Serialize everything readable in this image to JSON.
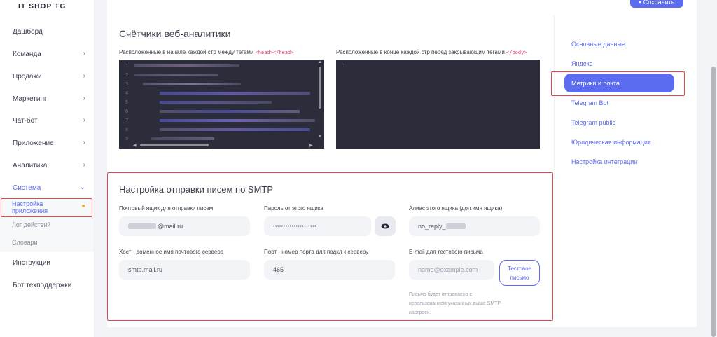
{
  "brand": "IT SHOP TG",
  "sidebar": {
    "items": [
      {
        "label": "Дашборд",
        "has_chevron": false
      },
      {
        "label": "Команда",
        "has_chevron": true
      },
      {
        "label": "Продажи",
        "has_chevron": true
      },
      {
        "label": "Маркетинг",
        "has_chevron": true
      },
      {
        "label": "Чат-бот",
        "has_chevron": true
      },
      {
        "label": "Приложение",
        "has_chevron": true
      },
      {
        "label": "Аналитика",
        "has_chevron": true
      },
      {
        "label": "Система",
        "has_chevron": true,
        "expanded": true
      }
    ],
    "sub_items": [
      "Настройка приложения",
      "Лог действий",
      "Словари"
    ],
    "bottom_items": [
      "Инструкции",
      "Бот техподдержки"
    ]
  },
  "toolbar": {
    "save_label": "Сохранить"
  },
  "analytics": {
    "title": "Счётчики веб-аналитики",
    "head_label": "Расположенные в начале каждой стр между тегами",
    "head_tag": "<head></head>",
    "body_label": "Расположенные в конце каждой стр перед закрывающим тегами",
    "body_tag": "</body>",
    "head_line_numbers": [
      "1",
      "2",
      "3",
      "4",
      "5",
      "6",
      "7",
      "8",
      "9"
    ],
    "body_line_numbers": [
      "1"
    ]
  },
  "smtp": {
    "title": "Настройка отправки писем по SMTP",
    "mailbox_label": "Почтовый ящик для отправки писем",
    "mailbox_value": "@mail.ru",
    "password_label": "Пароль от этого ящика",
    "password_value": "•••••••••••••••••••••",
    "alias_label": "Алиас этого ящика (доп имя ящика)",
    "alias_value": "no_reply_",
    "host_label": "Хост - доменное имя почтового сервера",
    "host_value": "smtp.mail.ru",
    "port_label": "Порт - номер порта для подкл к серверу",
    "port_value": "465",
    "test_email_label": "E-mail для тестового письма",
    "test_email_placeholder": "name@example.com",
    "test_button_line1": "Тестовое",
    "test_button_line2": "письмо",
    "hint": "Письмо будет отправлено с использованием указанных выше SMTP-настроек."
  },
  "settings_menu": {
    "items": [
      "Основные данные",
      "Яндекс",
      "Метрики и почта",
      "Telegram Bot",
      "Telegram public",
      "Юридическая информация",
      "Настройка интеграции"
    ],
    "active": "Метрики и почта"
  },
  "colors": {
    "accent": "#5b6cf0",
    "highlight": "#e2484a",
    "code_bg": "#2b2d3a"
  }
}
